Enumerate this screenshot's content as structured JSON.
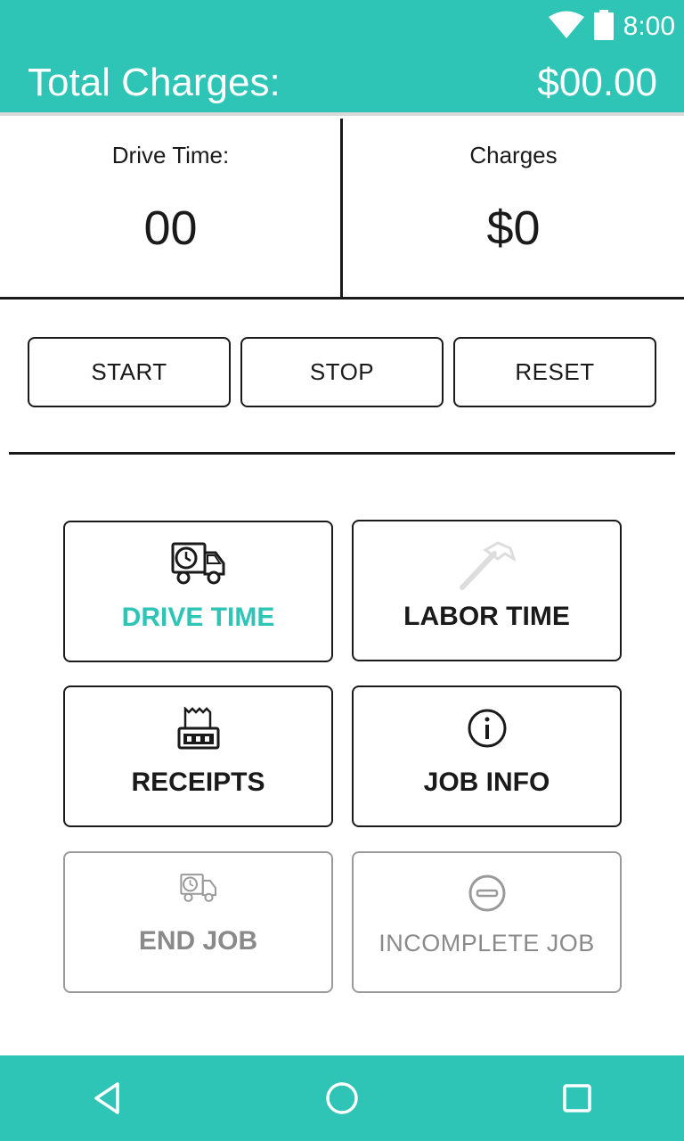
{
  "status_bar": {
    "time": "8:00",
    "icons": [
      "wifi-icon",
      "battery-icon"
    ]
  },
  "app_bar": {
    "title": "Total Charges:",
    "total": "$00.00"
  },
  "stats": {
    "drive_time_label": "Drive Time:",
    "drive_time_value": "00",
    "charges_label": "Charges",
    "charges_value": "$0"
  },
  "controls": {
    "start": "START",
    "stop": "STOP",
    "reset": "RESET"
  },
  "tiles": {
    "drive_time": {
      "label": "DRIVE TIME",
      "icon": "truck-clock-icon",
      "state": "selected"
    },
    "labor_time": {
      "label": "LABOR TIME",
      "icon": "hammer-icon",
      "state": "enabled"
    },
    "receipts": {
      "label": "RECEIPTS",
      "icon": "receipt-icon",
      "state": "enabled"
    },
    "job_info": {
      "label": "JOB INFO",
      "icon": "info-icon",
      "state": "enabled"
    },
    "end_job": {
      "label": "END JOB",
      "icon": "truck-clock-icon",
      "state": "disabled"
    },
    "incomplete_job": {
      "label": "INCOMPLETE JOB",
      "icon": "minus-circle-icon",
      "state": "disabled"
    }
  },
  "nav_bar": {
    "icons": [
      "back-icon",
      "home-icon",
      "recents-icon"
    ]
  },
  "colors": {
    "accent": "#2ec4b6",
    "text": "#1a1a1a",
    "disabled": "#8a8a8a",
    "background": "#ffffff"
  }
}
